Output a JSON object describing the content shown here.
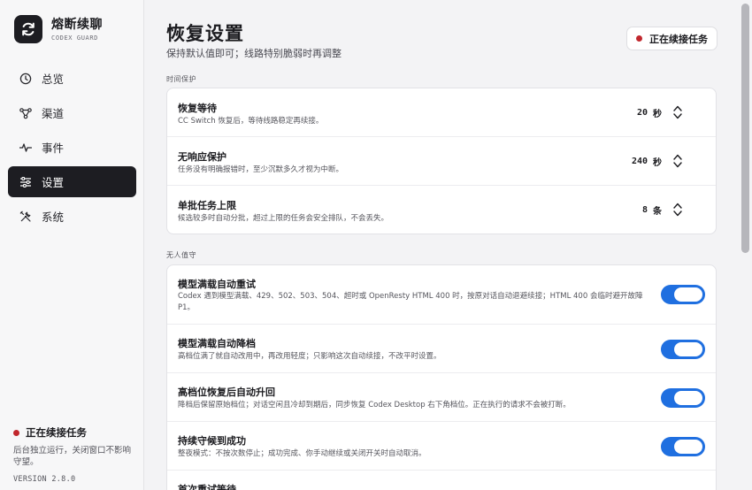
{
  "brand": {
    "name": "熔断续聊",
    "subtitle": "CODEX GUARD"
  },
  "nav": [
    {
      "label": "总览",
      "icon": "clock-icon",
      "active": false
    },
    {
      "label": "渠道",
      "icon": "network-icon",
      "active": false
    },
    {
      "label": "事件",
      "icon": "pulse-icon",
      "active": false
    },
    {
      "label": "设置",
      "icon": "sliders-icon",
      "active": true
    },
    {
      "label": "系统",
      "icon": "tools-icon",
      "active": false
    }
  ],
  "sidebar_status": {
    "label": "正在续接任务",
    "description": "后台独立运行，关闭窗口不影响守望。",
    "version": "VERSION 2.8.0"
  },
  "header": {
    "title": "恢复设置",
    "subtitle": "保持默认值即可；线路特别脆弱时再调整",
    "status_label": "正在续接任务"
  },
  "sections": [
    {
      "label": "时间保护"
    },
    {
      "label": "无人值守"
    }
  ],
  "time_protection": [
    {
      "title": "恢复等待",
      "description": "CC Switch 恢复后，等待线路稳定再续接。",
      "value": "20",
      "unit": "秒"
    },
    {
      "title": "无响应保护",
      "description": "任务没有明确报错时，至少沉默多久才视为中断。",
      "value": "240",
      "unit": "秒"
    },
    {
      "title": "单批任务上限",
      "description": "候选较多时自动分批，超过上限的任务会安全排队，不会丢失。",
      "value": "8",
      "unit": "条"
    }
  ],
  "unattended": [
    {
      "title": "模型满载自动重试",
      "description": "Codex 遇到模型满载、429、502、503、504、超时或 OpenResty HTML 400 时，按原对话自动退避续接；HTML 400 会临时避开故障 P1。",
      "enabled": true
    },
    {
      "title": "模型满载自动降档",
      "description": "高档位满了就自动改用中，再改用轻度；只影响这次自动续接，不改平时设置。",
      "enabled": true
    },
    {
      "title": "高档位恢复后自动升回",
      "description": "降档后保留原始档位；对话空闲且冷却到期后，同步恢复 Codex Desktop 右下角档位。正在执行的请求不会被打断。",
      "enabled": true
    },
    {
      "title": "持续守候到成功",
      "description": "整夜模式：不按次数停止；成功完成、你手动继续或关闭开关时自动取消。",
      "enabled": true
    },
    {
      "title": "首次重试等待",
      "description": "",
      "enabled": true
    }
  ],
  "colors": {
    "accent": "#1f6fe0",
    "dark": "#1d1d22",
    "status_red": "#c1272d"
  }
}
